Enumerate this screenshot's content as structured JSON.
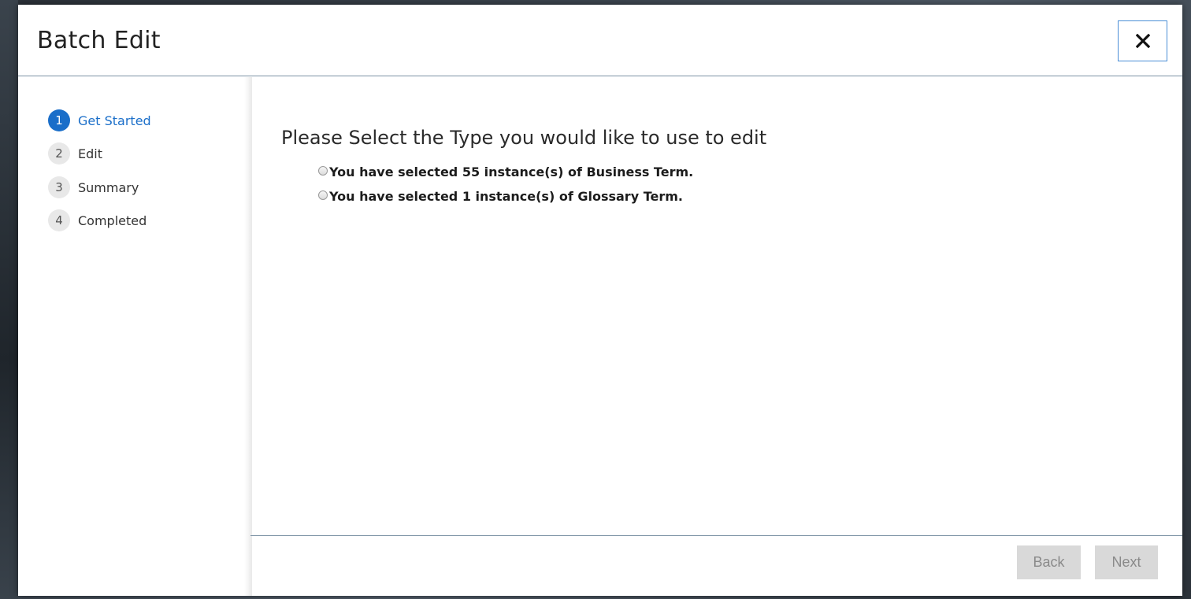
{
  "dialog": {
    "title": "Batch Edit",
    "close_icon": "close-icon"
  },
  "steps": [
    {
      "number": "1",
      "label": "Get Started",
      "active": true
    },
    {
      "number": "2",
      "label": "Edit",
      "active": false
    },
    {
      "number": "3",
      "label": "Summary",
      "active": false
    },
    {
      "number": "4",
      "label": "Completed",
      "active": false
    }
  ],
  "main": {
    "prompt": "Please Select the Type you would like to use to edit",
    "options": [
      {
        "label": "You have selected 55 instance(s) of Business Term.",
        "selected": false
      },
      {
        "label": "You have selected 1 instance(s) of Glossary Term.",
        "selected": false
      }
    ]
  },
  "footer": {
    "back_label": "Back",
    "next_label": "Next"
  },
  "colors": {
    "accent": "#1a6ec9",
    "divider": "#7c93a5",
    "disabled_button_bg": "#d9d9d9",
    "disabled_button_text": "#8a8a8a"
  }
}
